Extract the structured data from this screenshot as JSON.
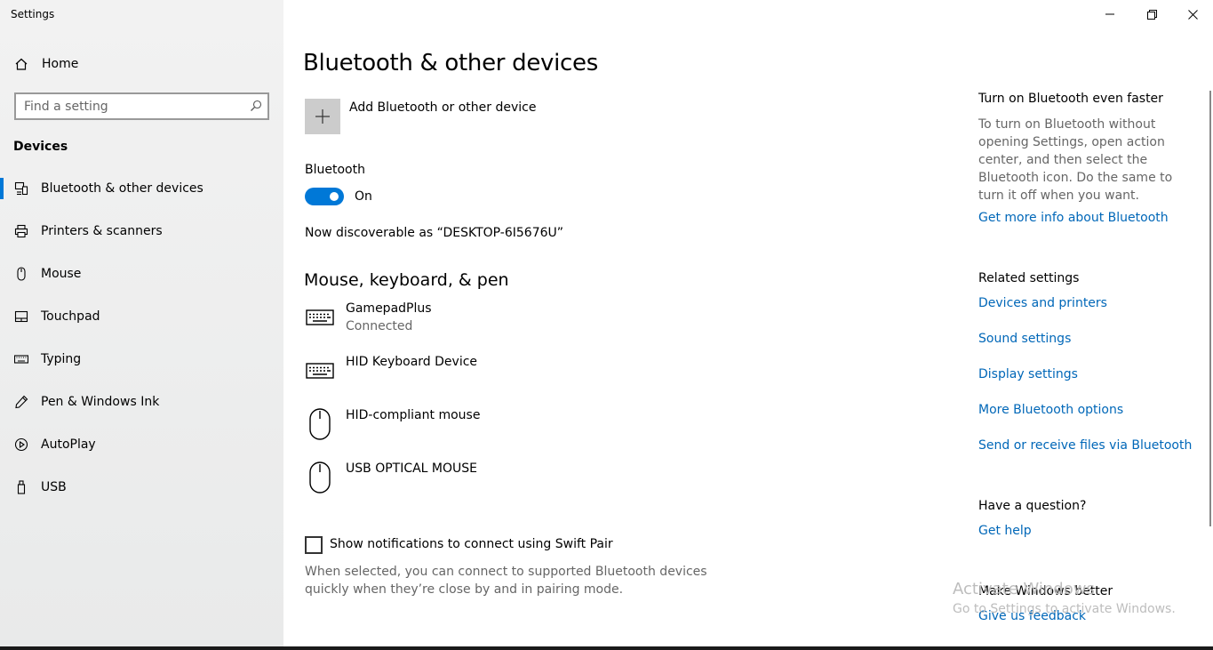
{
  "window": {
    "title": "Settings",
    "minimize_icon": "minimize-icon",
    "restore_icon": "restore-icon",
    "close_icon": "close-icon"
  },
  "sidebar": {
    "home_label": "Home",
    "search_placeholder": "Find a setting",
    "section_title": "Devices",
    "items": [
      {
        "label": "Bluetooth & other devices",
        "icon": "bluetooth-devices-icon",
        "active": true
      },
      {
        "label": "Printers & scanners",
        "icon": "printer-icon"
      },
      {
        "label": "Mouse",
        "icon": "mouse-icon"
      },
      {
        "label": "Touchpad",
        "icon": "touchpad-icon"
      },
      {
        "label": "Typing",
        "icon": "keyboard-icon"
      },
      {
        "label": "Pen & Windows Ink",
        "icon": "pen-icon"
      },
      {
        "label": "AutoPlay",
        "icon": "autoplay-icon"
      },
      {
        "label": "USB",
        "icon": "usb-icon"
      }
    ]
  },
  "main": {
    "title": "Bluetooth & other devices",
    "add_device_label": "Add Bluetooth or other device",
    "bluetooth_label": "Bluetooth",
    "bluetooth_state": "On",
    "discoverable_text": "Now discoverable as “DESKTOP-6I5676U”",
    "section_heading": "Mouse, keyboard, & pen",
    "devices": [
      {
        "name": "GamepadPlus",
        "status": "Connected",
        "icon": "keyboard-icon"
      },
      {
        "name": "HID Keyboard Device",
        "status": "",
        "icon": "keyboard-icon"
      },
      {
        "name": "HID-compliant mouse",
        "status": "",
        "icon": "mouse-icon"
      },
      {
        "name": "USB OPTICAL MOUSE",
        "status": "",
        "icon": "mouse-icon"
      }
    ],
    "swift_pair_label": "Show notifications to connect using Swift Pair",
    "swift_pair_desc": "When selected, you can connect to supported Bluetooth devices quickly when they’re close by and in pairing mode."
  },
  "side_panel": {
    "faster_heading": "Turn on Bluetooth even faster",
    "faster_text": "To turn on Bluetooth without opening Settings, open action center, and then select the Bluetooth icon. Do the same to turn it off when you want.",
    "faster_link": "Get more info about Bluetooth",
    "related_heading": "Related settings",
    "related_links": [
      "Devices and printers",
      "Sound settings",
      "Display settings",
      "More Bluetooth options",
      "Send or receive files via Bluetooth"
    ],
    "question_heading": "Have a question?",
    "question_link": "Get help",
    "better_heading": "Make Windows better",
    "better_link": "Give us feedback"
  },
  "watermark": {
    "line1": "Activate Windows",
    "line2": "Go to Settings to activate Windows."
  },
  "colors": {
    "accent": "#0078d7",
    "link": "#0067b8"
  }
}
